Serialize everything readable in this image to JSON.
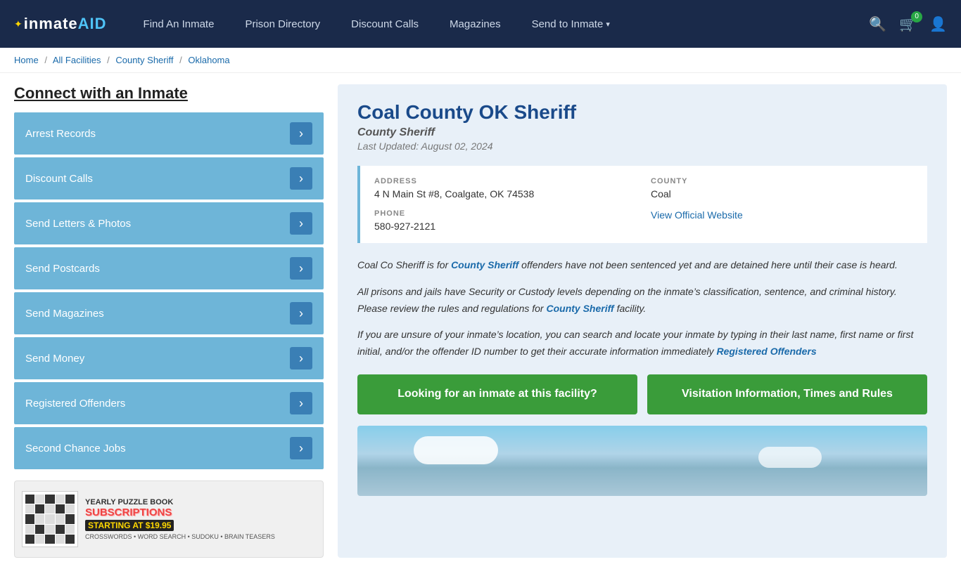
{
  "navbar": {
    "logo": "inmateAID",
    "logo_bird": "✦",
    "nav_links": [
      {
        "label": "Find An Inmate",
        "id": "find-inmate"
      },
      {
        "label": "Prison Directory",
        "id": "prison-directory"
      },
      {
        "label": "Discount Calls",
        "id": "discount-calls"
      },
      {
        "label": "Magazines",
        "id": "magazines"
      },
      {
        "label": "Send to Inmate",
        "id": "send-to-inmate"
      }
    ],
    "cart_count": "0",
    "search_label": "Search",
    "cart_label": "Cart",
    "user_label": "User"
  },
  "breadcrumb": {
    "home": "Home",
    "all_facilities": "All Facilities",
    "county_sheriff": "County Sheriff",
    "state": "Oklahoma"
  },
  "sidebar": {
    "title": "Connect with an Inmate",
    "menu_items": [
      "Arrest Records",
      "Discount Calls",
      "Send Letters & Photos",
      "Send Postcards",
      "Send Magazines",
      "Send Money",
      "Registered Offenders",
      "Second Chance Jobs"
    ],
    "ad": {
      "line1": "YEARLY PUZZLE BOOK",
      "line2": "SUBSCRIPTIONS",
      "line3": "STARTING AT $19.95",
      "desc": "CROSSWORDS • WORD SEARCH • SUDOKU • BRAIN TEASERS"
    }
  },
  "facility": {
    "title": "Coal County OK Sheriff",
    "type": "County Sheriff",
    "last_updated": "Last Updated: August 02, 2024",
    "address_label": "ADDRESS",
    "address_value": "4 N Main St #8, Coalgate, OK 74538",
    "county_label": "COUNTY",
    "county_value": "Coal",
    "phone_label": "PHONE",
    "phone_value": "580-927-2121",
    "website_label": "View Official Website",
    "description1": "Coal Co Sheriff is for ",
    "desc_link1": "County Sheriff",
    "description1b": " offenders have not been sentenced yet and are detained here until their case is heard.",
    "description2": "All prisons and jails have Security or Custody levels depending on the inmate’s classification, sentence, and criminal history. Please review the rules and regulations for ",
    "desc_link2": "County Sheriff",
    "description2b": " facility.",
    "description3": "If you are unsure of your inmate’s location, you can search and locate your inmate by typing in their last name, first name or first initial, and/or the offender ID number to get their accurate information immediately ",
    "desc_link3": "Registered Offenders",
    "btn1": "Looking for an inmate at this facility?",
    "btn2": "Visitation Information, Times and Rules"
  }
}
